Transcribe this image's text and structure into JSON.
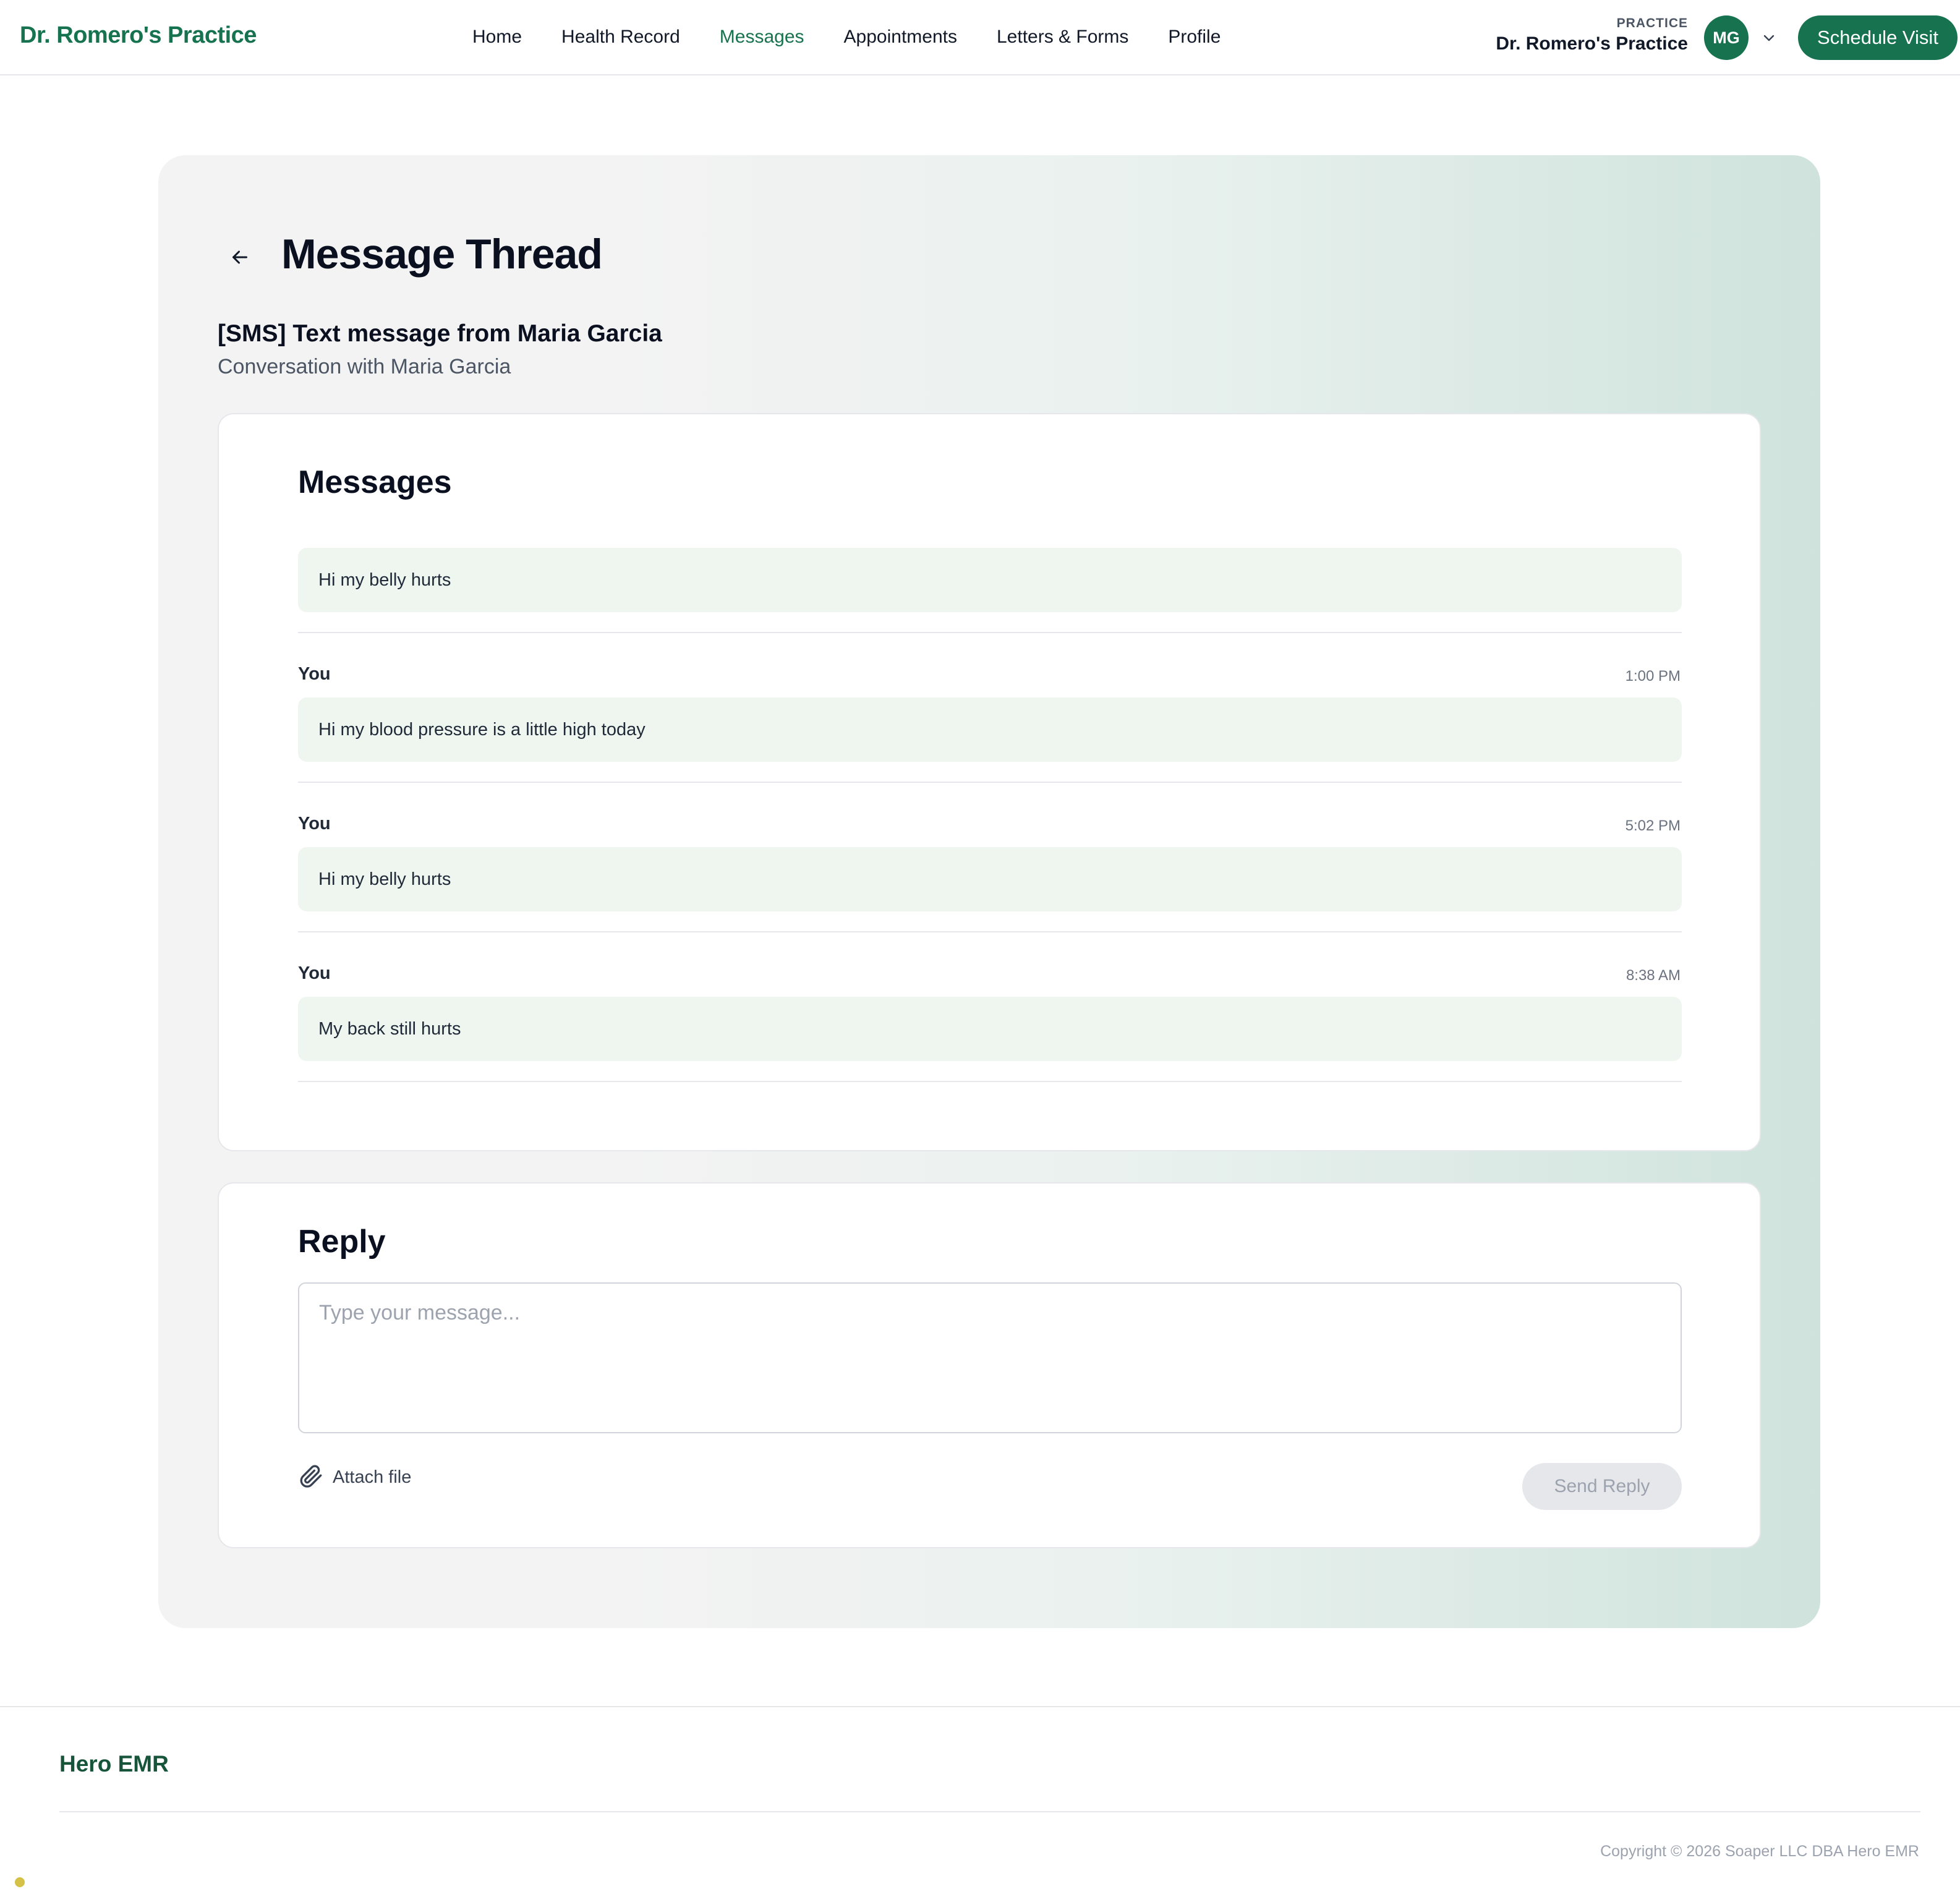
{
  "header": {
    "brand": "Dr. Romero's Practice",
    "nav": [
      {
        "label": "Home",
        "active": false
      },
      {
        "label": "Health Record",
        "active": false
      },
      {
        "label": "Messages",
        "active": true
      },
      {
        "label": "Appointments",
        "active": false
      },
      {
        "label": "Letters & Forms",
        "active": false
      },
      {
        "label": "Profile",
        "active": false
      }
    ],
    "practice_label": "PRACTICE",
    "practice_name": "Dr. Romero's Practice",
    "avatar_initials": "MG",
    "avatar_menu_icon": "chevron-down-icon",
    "schedule_button": "Schedule Visit"
  },
  "thread": {
    "back_icon": "arrow-left-icon",
    "page_title": "Message Thread",
    "subject": "[SMS] Text message from Maria Garcia",
    "subtitle": "Conversation with Maria Garcia"
  },
  "messages_card": {
    "title": "Messages",
    "messages": [
      {
        "sender": "",
        "time": "",
        "text": "Hi my belly hurts"
      },
      {
        "sender": "You",
        "time": "1:00 PM",
        "text": "Hi my blood pressure is a little high today"
      },
      {
        "sender": "You",
        "time": "5:02 PM",
        "text": "Hi my belly hurts"
      },
      {
        "sender": "You",
        "time": "8:38 AM",
        "text": "My back still hurts"
      }
    ]
  },
  "reply_card": {
    "title": "Reply",
    "placeholder": "Type your message...",
    "value": "",
    "attach_icon": "paperclip-icon",
    "attach_label": "Attach file",
    "send_button": "Send Reply",
    "send_enabled": false
  },
  "footer": {
    "brand": "Hero EMR",
    "copyright": "Copyright © 2026 Soaper LLC DBA Hero EMR"
  },
  "colors": {
    "brand_green": "#17734f",
    "bubble_bg": "#eff6f0",
    "disabled_button": "#e5e7eb"
  }
}
